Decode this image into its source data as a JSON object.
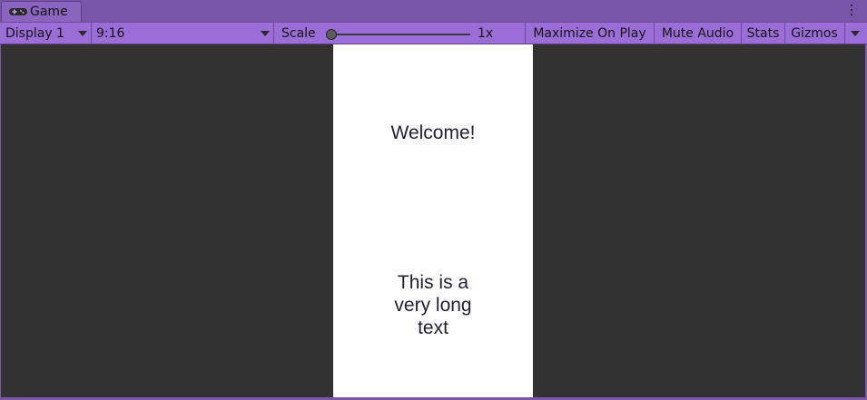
{
  "tab": {
    "label": "Game",
    "icon": "gamepad-icon"
  },
  "toolbar": {
    "display_label": "Display 1",
    "aspect_label": "9:16",
    "scale_label": "Scale",
    "scale_value": "1x",
    "scale_level": 0,
    "maximize_label": "Maximize On Play",
    "mute_label": "Mute Audio",
    "stats_label": "Stats",
    "gizmos_label": "Gizmos"
  },
  "game": {
    "welcome_text": "Welcome!",
    "long_text": "This is a very long text"
  },
  "colors": {
    "toolbar_bg": "#9b6dd6",
    "tab_bg": "#8b64bf",
    "game_bg": "#323232",
    "canvas_bg": "#ffffff",
    "text": "#231f33"
  }
}
